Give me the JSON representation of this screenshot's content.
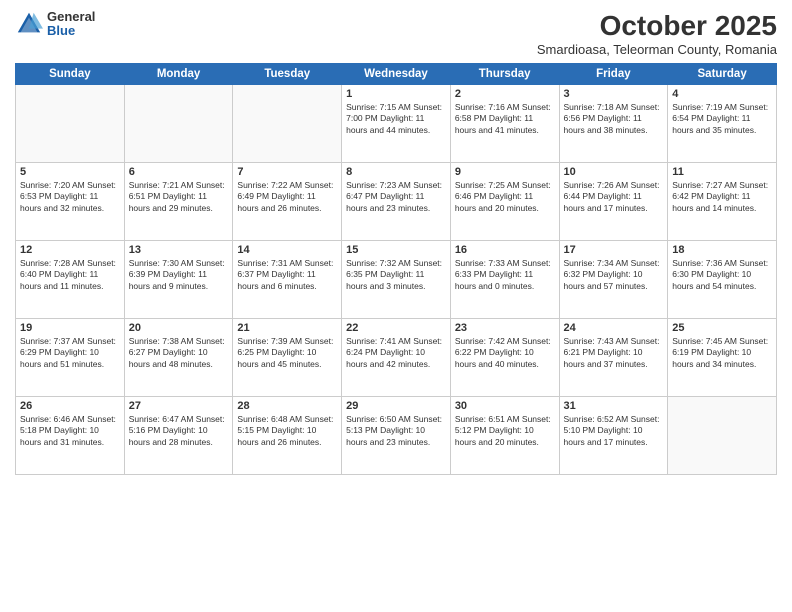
{
  "header": {
    "logo_general": "General",
    "logo_blue": "Blue",
    "month_title": "October 2025",
    "location": "Smardioasa, Teleorman County, Romania"
  },
  "days_of_week": [
    "Sunday",
    "Monday",
    "Tuesday",
    "Wednesday",
    "Thursday",
    "Friday",
    "Saturday"
  ],
  "weeks": [
    [
      {
        "day": "",
        "info": ""
      },
      {
        "day": "",
        "info": ""
      },
      {
        "day": "",
        "info": ""
      },
      {
        "day": "1",
        "info": "Sunrise: 7:15 AM\nSunset: 7:00 PM\nDaylight: 11 hours\nand 44 minutes."
      },
      {
        "day": "2",
        "info": "Sunrise: 7:16 AM\nSunset: 6:58 PM\nDaylight: 11 hours\nand 41 minutes."
      },
      {
        "day": "3",
        "info": "Sunrise: 7:18 AM\nSunset: 6:56 PM\nDaylight: 11 hours\nand 38 minutes."
      },
      {
        "day": "4",
        "info": "Sunrise: 7:19 AM\nSunset: 6:54 PM\nDaylight: 11 hours\nand 35 minutes."
      }
    ],
    [
      {
        "day": "5",
        "info": "Sunrise: 7:20 AM\nSunset: 6:53 PM\nDaylight: 11 hours\nand 32 minutes."
      },
      {
        "day": "6",
        "info": "Sunrise: 7:21 AM\nSunset: 6:51 PM\nDaylight: 11 hours\nand 29 minutes."
      },
      {
        "day": "7",
        "info": "Sunrise: 7:22 AM\nSunset: 6:49 PM\nDaylight: 11 hours\nand 26 minutes."
      },
      {
        "day": "8",
        "info": "Sunrise: 7:23 AM\nSunset: 6:47 PM\nDaylight: 11 hours\nand 23 minutes."
      },
      {
        "day": "9",
        "info": "Sunrise: 7:25 AM\nSunset: 6:46 PM\nDaylight: 11 hours\nand 20 minutes."
      },
      {
        "day": "10",
        "info": "Sunrise: 7:26 AM\nSunset: 6:44 PM\nDaylight: 11 hours\nand 17 minutes."
      },
      {
        "day": "11",
        "info": "Sunrise: 7:27 AM\nSunset: 6:42 PM\nDaylight: 11 hours\nand 14 minutes."
      }
    ],
    [
      {
        "day": "12",
        "info": "Sunrise: 7:28 AM\nSunset: 6:40 PM\nDaylight: 11 hours\nand 11 minutes."
      },
      {
        "day": "13",
        "info": "Sunrise: 7:30 AM\nSunset: 6:39 PM\nDaylight: 11 hours\nand 9 minutes."
      },
      {
        "day": "14",
        "info": "Sunrise: 7:31 AM\nSunset: 6:37 PM\nDaylight: 11 hours\nand 6 minutes."
      },
      {
        "day": "15",
        "info": "Sunrise: 7:32 AM\nSunset: 6:35 PM\nDaylight: 11 hours\nand 3 minutes."
      },
      {
        "day": "16",
        "info": "Sunrise: 7:33 AM\nSunset: 6:33 PM\nDaylight: 11 hours\nand 0 minutes."
      },
      {
        "day": "17",
        "info": "Sunrise: 7:34 AM\nSunset: 6:32 PM\nDaylight: 10 hours\nand 57 minutes."
      },
      {
        "day": "18",
        "info": "Sunrise: 7:36 AM\nSunset: 6:30 PM\nDaylight: 10 hours\nand 54 minutes."
      }
    ],
    [
      {
        "day": "19",
        "info": "Sunrise: 7:37 AM\nSunset: 6:29 PM\nDaylight: 10 hours\nand 51 minutes."
      },
      {
        "day": "20",
        "info": "Sunrise: 7:38 AM\nSunset: 6:27 PM\nDaylight: 10 hours\nand 48 minutes."
      },
      {
        "day": "21",
        "info": "Sunrise: 7:39 AM\nSunset: 6:25 PM\nDaylight: 10 hours\nand 45 minutes."
      },
      {
        "day": "22",
        "info": "Sunrise: 7:41 AM\nSunset: 6:24 PM\nDaylight: 10 hours\nand 42 minutes."
      },
      {
        "day": "23",
        "info": "Sunrise: 7:42 AM\nSunset: 6:22 PM\nDaylight: 10 hours\nand 40 minutes."
      },
      {
        "day": "24",
        "info": "Sunrise: 7:43 AM\nSunset: 6:21 PM\nDaylight: 10 hours\nand 37 minutes."
      },
      {
        "day": "25",
        "info": "Sunrise: 7:45 AM\nSunset: 6:19 PM\nDaylight: 10 hours\nand 34 minutes."
      }
    ],
    [
      {
        "day": "26",
        "info": "Sunrise: 6:46 AM\nSunset: 5:18 PM\nDaylight: 10 hours\nand 31 minutes."
      },
      {
        "day": "27",
        "info": "Sunrise: 6:47 AM\nSunset: 5:16 PM\nDaylight: 10 hours\nand 28 minutes."
      },
      {
        "day": "28",
        "info": "Sunrise: 6:48 AM\nSunset: 5:15 PM\nDaylight: 10 hours\nand 26 minutes."
      },
      {
        "day": "29",
        "info": "Sunrise: 6:50 AM\nSunset: 5:13 PM\nDaylight: 10 hours\nand 23 minutes."
      },
      {
        "day": "30",
        "info": "Sunrise: 6:51 AM\nSunset: 5:12 PM\nDaylight: 10 hours\nand 20 minutes."
      },
      {
        "day": "31",
        "info": "Sunrise: 6:52 AM\nSunset: 5:10 PM\nDaylight: 10 hours\nand 17 minutes."
      },
      {
        "day": "",
        "info": ""
      }
    ]
  ]
}
